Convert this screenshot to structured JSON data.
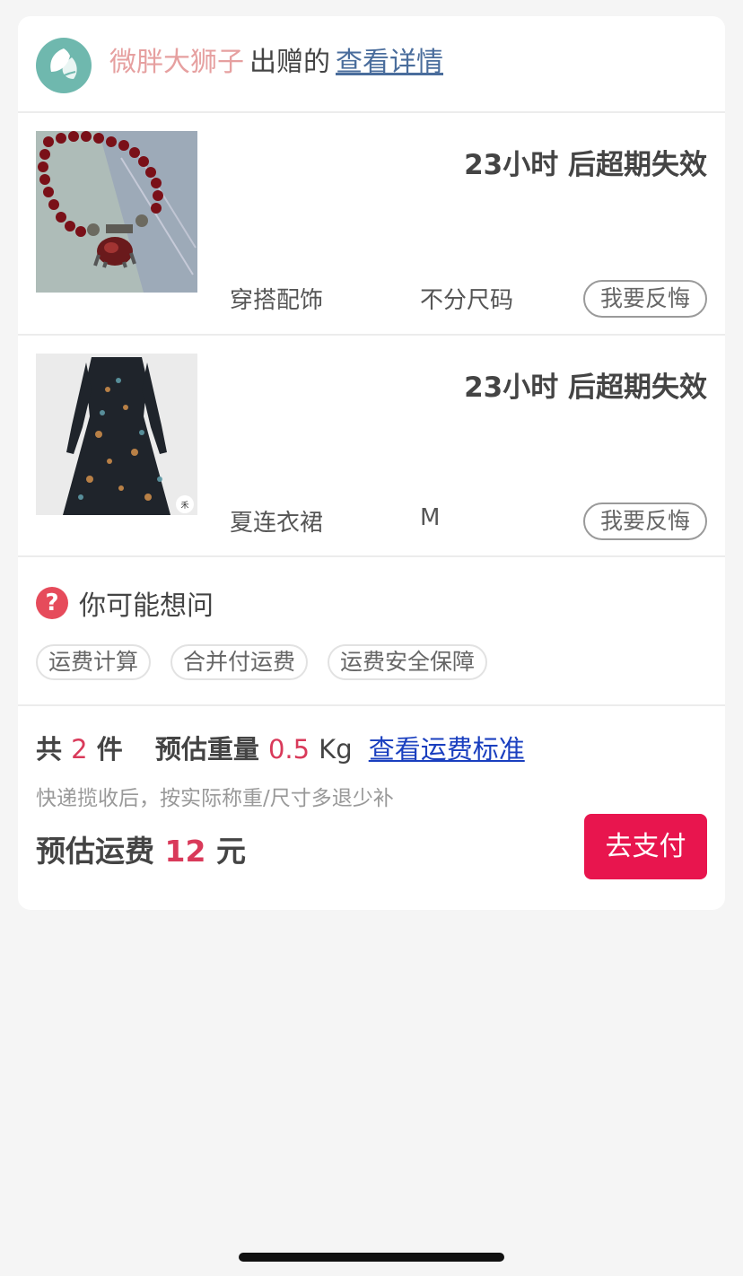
{
  "header": {
    "donor_name": "微胖大狮子",
    "donated_text": "出赠的",
    "detail_link": "查看详情"
  },
  "items": [
    {
      "expire_text": "23小时 后超期失效",
      "category": "穿搭配饰",
      "size": "不分尺码",
      "regret_button": "我要反悔",
      "thumb_icon": "bracelet-image"
    },
    {
      "expire_text": "23小时 后超期失效",
      "category": "夏连衣裙",
      "size": "M",
      "regret_button": "我要反悔",
      "thumb_icon": "dress-image"
    }
  ],
  "faq": {
    "title": "你可能想问",
    "icon": "question-icon",
    "chips": [
      "运费计算",
      "合并付运费",
      "运费安全保障"
    ]
  },
  "summary": {
    "count_prefix": "共",
    "count": "2",
    "count_unit": "件",
    "weight_label": "预估重量",
    "weight_value": "0.5",
    "weight_unit": "Kg",
    "standard_link": "查看运费标准",
    "note": "快递揽收后，按实际称重/尺寸多退少补",
    "fee_label": "预估运费",
    "fee_value": "12",
    "fee_unit": "元",
    "pay_button": "去支付"
  },
  "colors": {
    "accent": "#e8154e",
    "price": "#d93a5a",
    "donor_name": "#e6a0a0",
    "link": "#4a6d9c",
    "logo": "#6fb8ae"
  }
}
